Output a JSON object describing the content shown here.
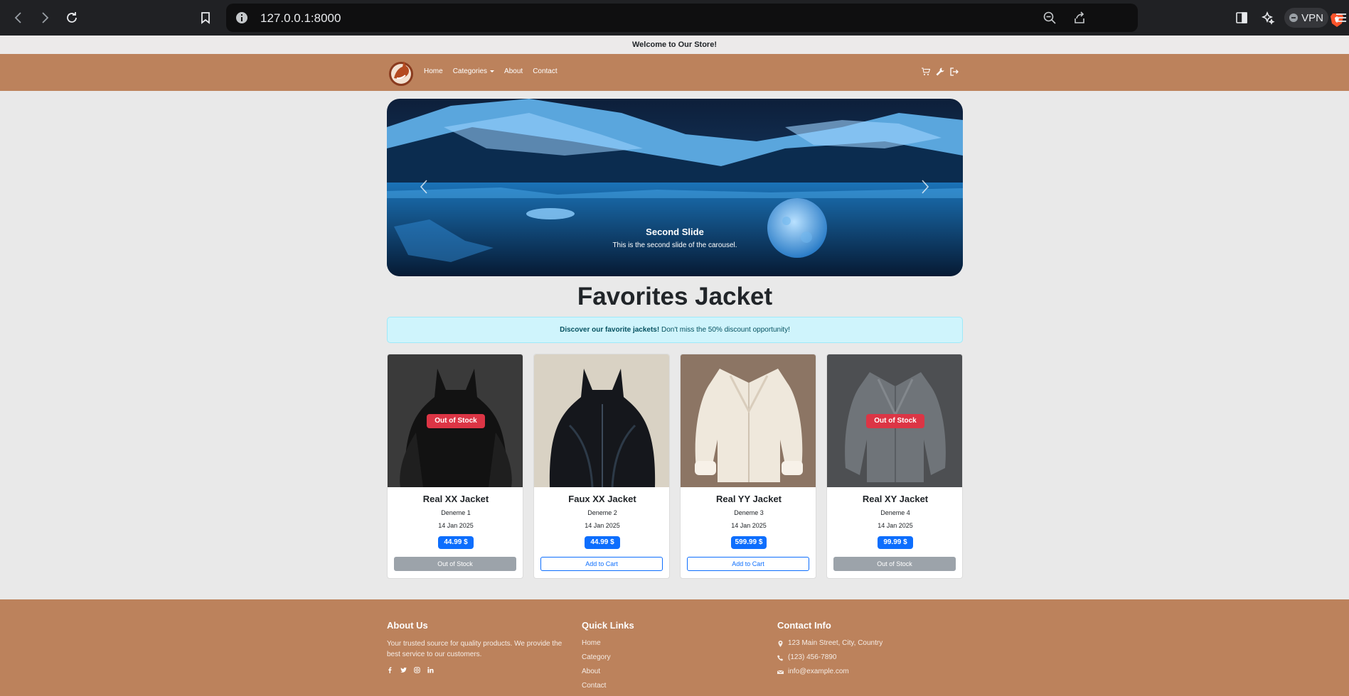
{
  "browser": {
    "url": "127.0.0.1:8000",
    "vpn_label": "VPN"
  },
  "banner": {
    "text": "Welcome to Our Store!"
  },
  "nav": {
    "links": [
      "Home",
      "Categories",
      "About",
      "Contact"
    ]
  },
  "carousel": {
    "title": "Second Slide",
    "text": "This is the second slide of the carousel."
  },
  "section": {
    "title": "Favorites Jacket",
    "alert_bold": "Discover our favorite jackets!",
    "alert_rest": "Don't miss the 50% discount opportunity!"
  },
  "products": [
    {
      "name": "Real XX Jacket",
      "desc": "Deneme 1",
      "date": "14 Jan 2025",
      "price": "44.99 $",
      "badge": "Out of Stock",
      "button": "Out of Stock"
    },
    {
      "name": "Faux XX Jacket",
      "desc": "Deneme 2",
      "date": "14 Jan 2025",
      "price": "44.99 $",
      "badge": "",
      "button": "Add to Cart"
    },
    {
      "name": "Real YY Jacket",
      "desc": "Deneme 3",
      "date": "14 Jan 2025",
      "price": "599.99 $",
      "badge": "",
      "button": "Add to Cart"
    },
    {
      "name": "Real XY Jacket",
      "desc": "Deneme 4",
      "date": "14 Jan 2025",
      "price": "99.99 $",
      "badge": "Out of Stock",
      "button": "Out of Stock"
    }
  ],
  "footer": {
    "about": {
      "heading": "About Us",
      "text": "Your trusted source for quality products. We provide the best service to our customers."
    },
    "quick_links": {
      "heading": "Quick Links",
      "items": [
        "Home",
        "Category",
        "About",
        "Contact"
      ]
    },
    "contact": {
      "heading": "Contact Info",
      "address": "123 Main Street, City, Country",
      "phone": "(123) 456-7890",
      "email": "info@example.com"
    }
  },
  "colors": {
    "brand": "#bc825c",
    "out_of_stock": "#dc3545",
    "price": "#0d6efd"
  }
}
